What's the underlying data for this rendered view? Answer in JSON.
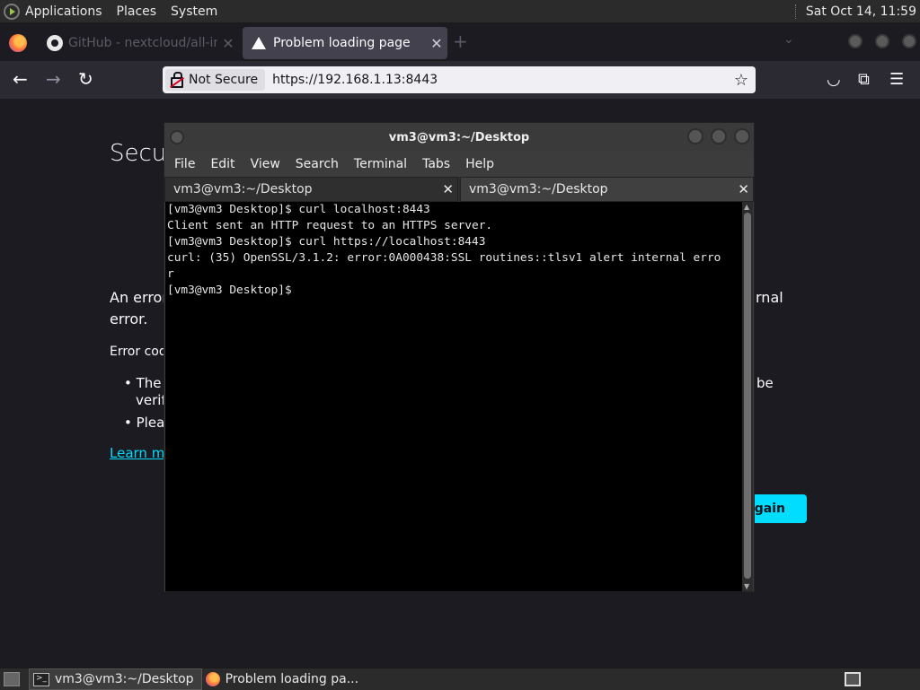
{
  "top_panel": {
    "menus": [
      "Applications",
      "Places",
      "System"
    ],
    "clock": "Sat Oct 14, 11:59"
  },
  "firefox": {
    "tabs": [
      {
        "title": "GitHub - nextcloud/all-in-",
        "icon": "github-icon",
        "active": false
      },
      {
        "title": "Problem loading page",
        "icon": "warning-icon",
        "active": true
      }
    ],
    "url": "https://192.168.1.13:8443",
    "security_label": "Not Secure"
  },
  "error_page": {
    "title_fragment": "Secu",
    "line1_fragment": "An error",
    "line1_end": "rnal",
    "line2": "error.",
    "code_fragment": "Error cod",
    "bullet1_start": "The",
    "bullet1_end": "be",
    "bullet1_line2": "verif",
    "bullet2_start": "Pleas",
    "learn_more": "Learn mo",
    "try_again": "Again"
  },
  "terminal": {
    "title": "vm3@vm3:~/Desktop",
    "menu": [
      "File",
      "Edit",
      "View",
      "Search",
      "Terminal",
      "Tabs",
      "Help"
    ],
    "tabs": [
      "vm3@vm3:~/Desktop",
      "vm3@vm3:~/Desktop"
    ],
    "lines": [
      "[vm3@vm3 Desktop]$ curl localhost:8443",
      "Client sent an HTTP request to an HTTPS server.",
      "[vm3@vm3 Desktop]$ curl https://localhost:8443",
      "curl: (35) OpenSSL/3.1.2: error:0A000438:SSL routines::tlsv1 alert internal erro",
      "r",
      "[vm3@vm3 Desktop]$ "
    ]
  },
  "taskbar": {
    "items": [
      {
        "label": "vm3@vm3:~/Desktop",
        "active": true
      },
      {
        "label": "Problem loading pa...",
        "active": false
      }
    ]
  }
}
